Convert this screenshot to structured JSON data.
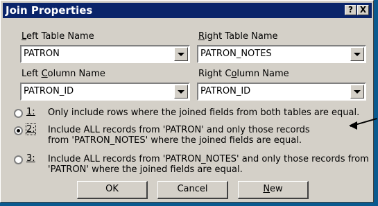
{
  "dialog": {
    "title": "Join Properties",
    "help_button": "?",
    "close_button": "X"
  },
  "left_table": {
    "label_pre": "",
    "label_u": "L",
    "label_post": "eft Table Name",
    "value": "PATRON"
  },
  "right_table": {
    "label_pre": "",
    "label_u": "R",
    "label_post": "ight Table Name",
    "value": "PATRON_NOTES"
  },
  "left_column": {
    "label_pre": "Left ",
    "label_u": "C",
    "label_post": "olumn Name",
    "value": "PATRON_ID"
  },
  "right_column": {
    "label_pre": "Right C",
    "label_u": "o",
    "label_post": "lumn Name",
    "value": "PATRON_ID"
  },
  "options": [
    {
      "number": "1:",
      "text": "Only include rows where the joined fields from both tables are equal.",
      "selected": false
    },
    {
      "number": "2:",
      "text": "Include ALL records from 'PATRON' and only those records from 'PATRON_NOTES' where the joined fields are equal.",
      "selected": true
    },
    {
      "number": "3:",
      "text": "Include ALL records from 'PATRON_NOTES' and only those records from 'PATRON' where the joined fields are equal.",
      "selected": false
    }
  ],
  "buttons": {
    "ok": "OK",
    "cancel": "Cancel",
    "new_pre": "",
    "new_u": "N",
    "new_post": "ew"
  },
  "colors": {
    "titlebar": "#0a246a",
    "face": "#d4d0c8",
    "desktop": "#0a5a8f"
  }
}
